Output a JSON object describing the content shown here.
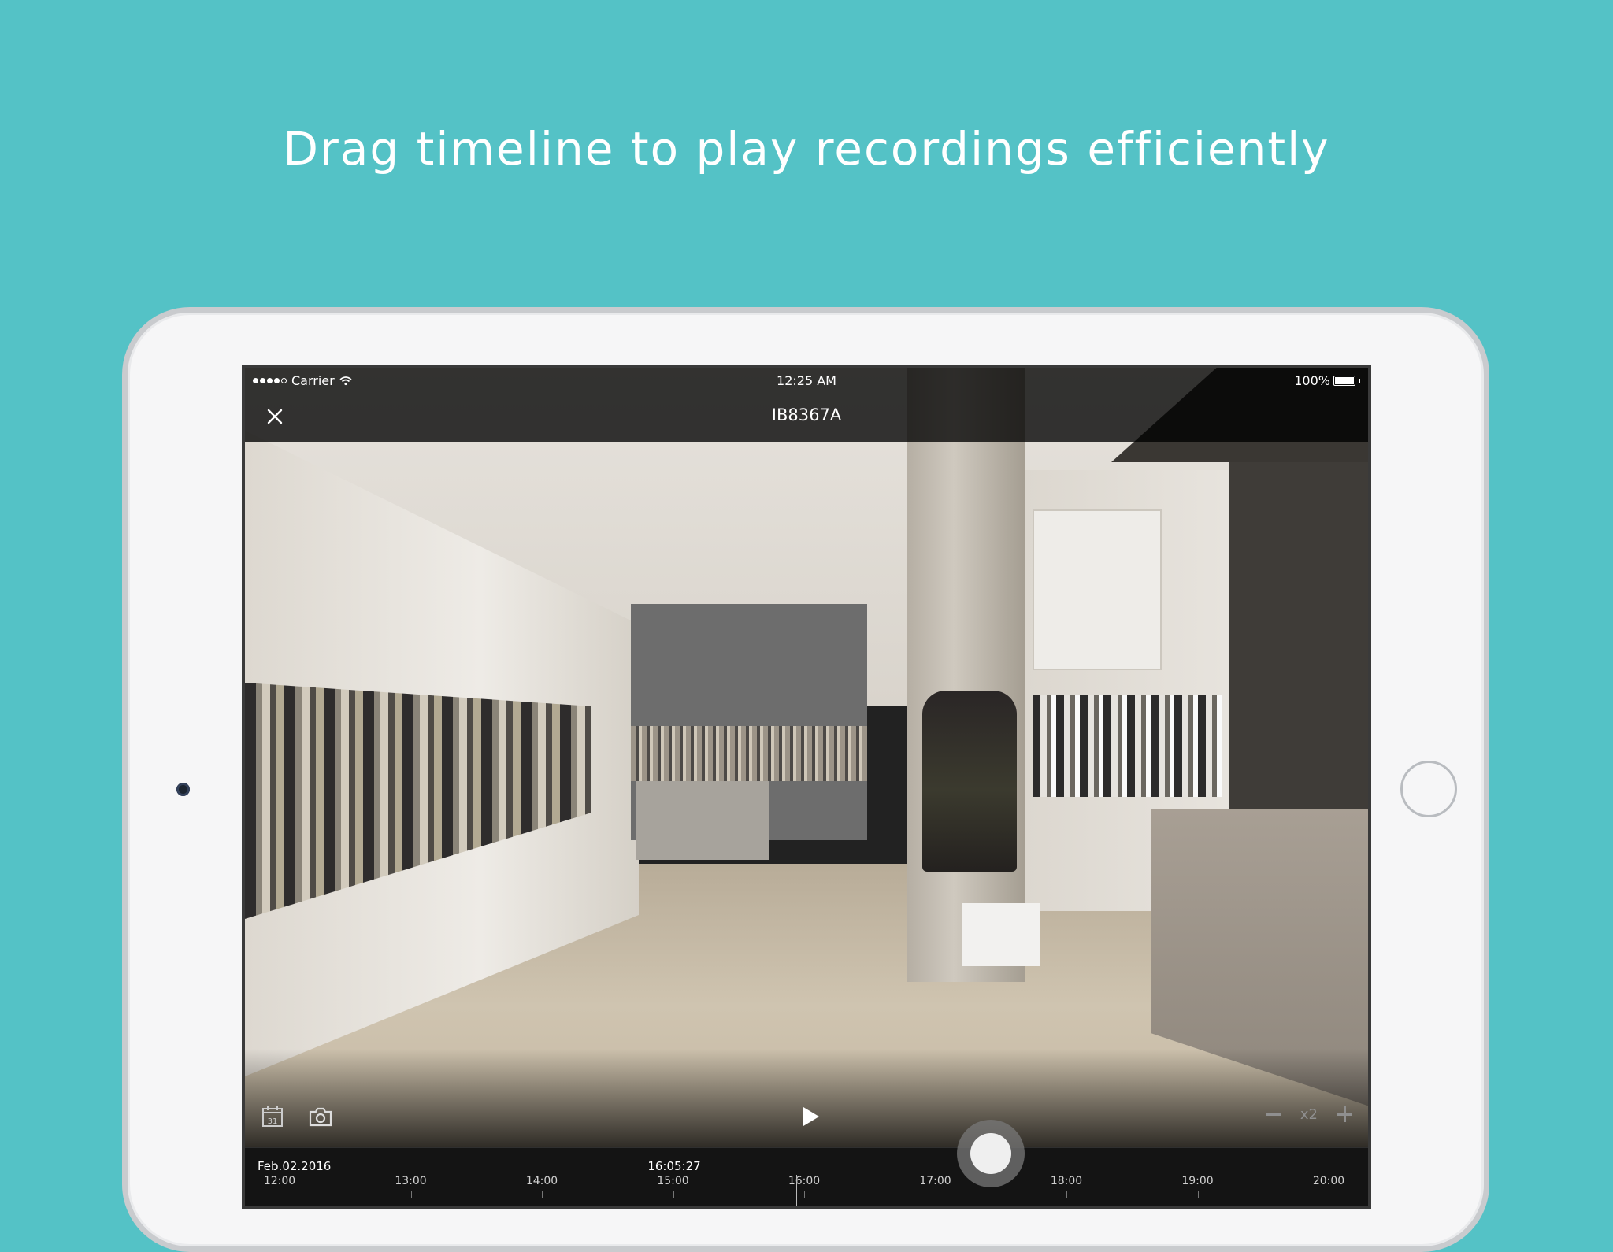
{
  "headline": "Drag timeline to play recordings efficiently",
  "status_bar": {
    "carrier": "Carrier",
    "time": "12:25 AM",
    "battery": "100%",
    "signal_bars": 4,
    "signal_total": 5
  },
  "nav": {
    "title": "IB8367A",
    "close_icon": "close-icon"
  },
  "controls": {
    "calendar_icon": "calendar-icon",
    "calendar_day": "31",
    "snapshot_icon": "camera-icon",
    "play_icon": "play-icon",
    "speed_label": "x2"
  },
  "timeline": {
    "date": "Feb.02.2016",
    "current_time": "16:05:27",
    "hours": [
      "12:00",
      "13:00",
      "14:00",
      "15:00",
      "16:00",
      "17:00",
      "18:00",
      "19:00",
      "20:00"
    ],
    "recorded_fraction": 0.587,
    "accent_color": "#4fc1c5"
  },
  "colors": {
    "background": "#54c2c6"
  }
}
